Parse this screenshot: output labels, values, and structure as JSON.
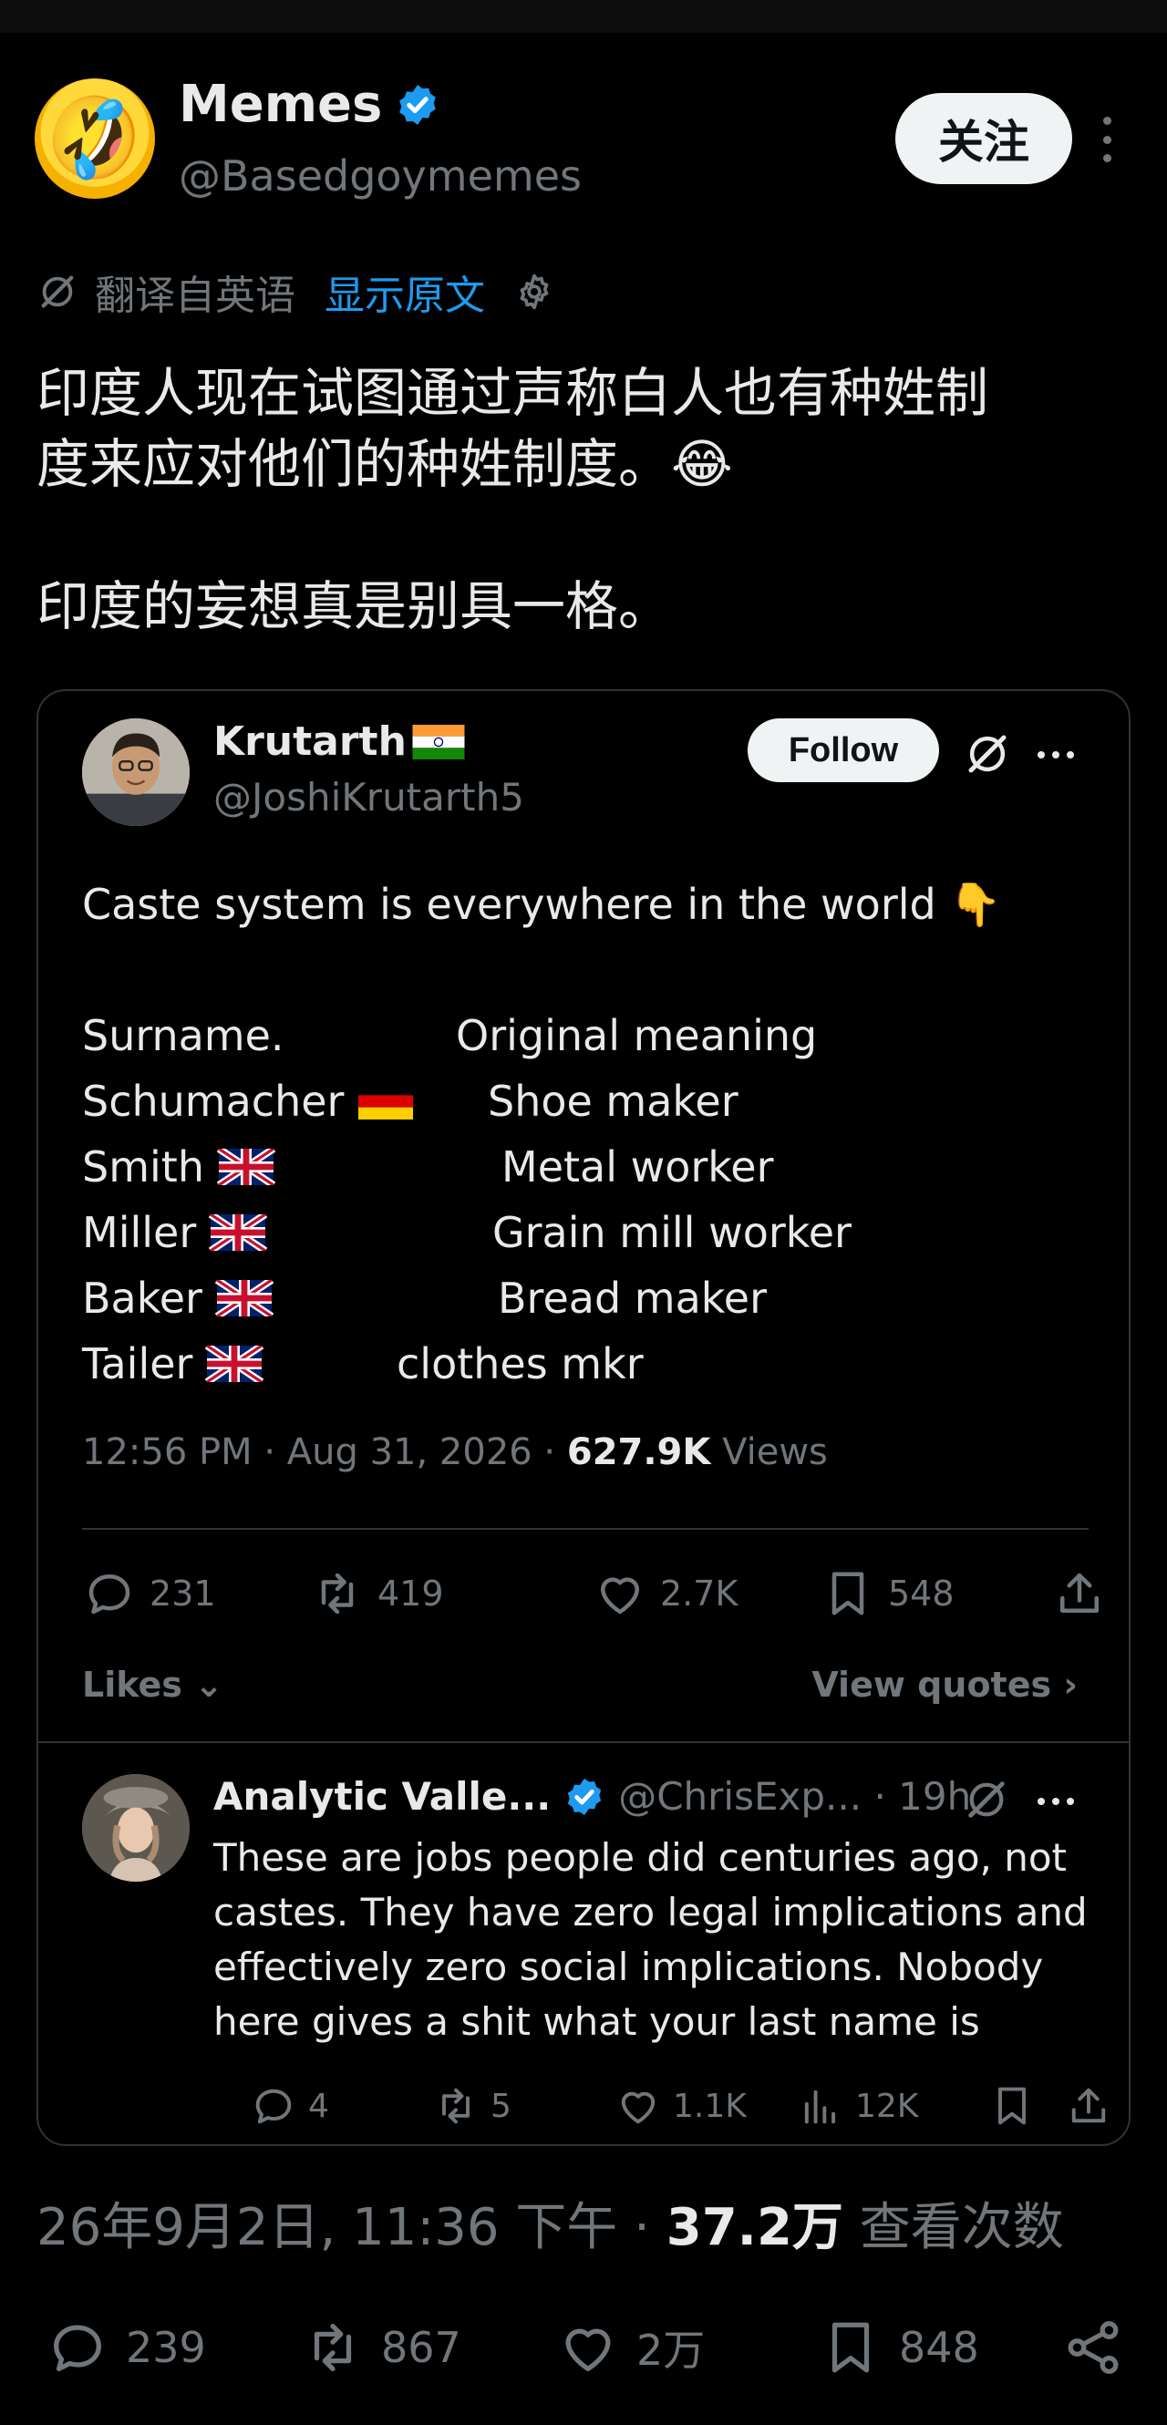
{
  "post": {
    "author": {
      "name": "Memes",
      "handle": "@Basedgoymemes",
      "avatar_emoji": "🤣",
      "verified": true
    },
    "follow_label": "关注",
    "translation": {
      "label": "翻译自英语",
      "show_original": "显示原文"
    },
    "text": {
      "line1": "印度人现在试图通过声称白人也有种姓制",
      "line2": "度来应对他们的种姓制度。😂",
      "line3": "印度的妄想真是别具一格。"
    },
    "timestamp": "26年9月2日, 11:36 下午",
    "views_value": "37.2万",
    "views_label": "查看次数",
    "actions": {
      "replies": "239",
      "reposts": "867",
      "likes": "2万",
      "bookmarks": "848"
    }
  },
  "quote": {
    "author": {
      "name": "Krutarth",
      "handle": "@JoshiKrutarth5"
    },
    "follow_label": "Follow",
    "text_intro": "Caste system is everywhere in the world 👇",
    "table": {
      "header": {
        "surname": "Surname.",
        "meaning": "Original meaning"
      },
      "rows": [
        {
          "surname": "Schumacher",
          "flag": "germany-flag",
          "meaning": "Shoe maker"
        },
        {
          "surname": "Smith",
          "flag": "uk-flag",
          "meaning": "Metal worker"
        },
        {
          "surname": "Miller",
          "flag": "uk-flag",
          "meaning": "Grain mill worker"
        },
        {
          "surname": "Baker",
          "flag": "uk-flag",
          "meaning": "Bread maker"
        },
        {
          "surname": "Tailer",
          "flag": "uk-flag",
          "meaning": "clothes mkr"
        }
      ]
    },
    "time": "12:56 PM · Aug 31, 2026 · ",
    "views_value": "627.9K",
    "views_label": " Views",
    "actions": {
      "replies": "231",
      "reposts": "419",
      "likes": "2.7K",
      "bookmarks": "548"
    },
    "likes_link": "Likes",
    "quotes_link": "View quotes",
    "reply": {
      "name": "Analytic Valle...",
      "handle": "@ChrisExp... · 19h",
      "text": "These are jobs people did centuries ago, not castes. They have zero legal implications and effectively zero social implications. Nobody here gives a shit what your last name is",
      "actions": {
        "replies": "4",
        "reposts": "5",
        "likes": "1.1K",
        "views": "12K"
      }
    }
  },
  "colors": {
    "background": "#000000",
    "accent": "#1d9bf0",
    "muted": "#71767b",
    "text": "#e7e9ea"
  }
}
